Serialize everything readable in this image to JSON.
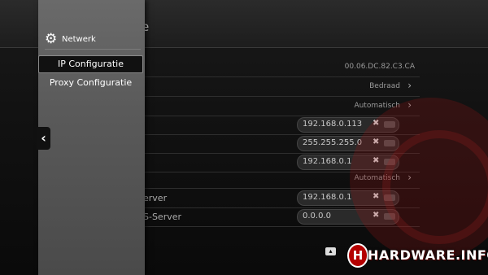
{
  "header": {
    "title": "e"
  },
  "sidebar": {
    "title": "Netwerk",
    "items": [
      {
        "label": "IP Configuratie"
      },
      {
        "label": "Proxy Configuratie"
      }
    ]
  },
  "rows": [
    {
      "label": "",
      "value": "00.06.DC.82.C3.CA"
    },
    {
      "label": "",
      "value": "Bedraad"
    },
    {
      "label": "",
      "value": "Automatisch"
    },
    {
      "label": "",
      "field": "192.168.0.113"
    },
    {
      "label": "",
      "field": "255.255.255.0"
    },
    {
      "label": "",
      "field": "192.168.0.1"
    },
    {
      "label": "",
      "value": "Automatisch"
    },
    {
      "label": "erver",
      "field": "192.168.0.1"
    },
    {
      "label": "S-Server",
      "field": "0.0.0.0"
    }
  ],
  "watermark": {
    "text": "HARDWARE.INFO",
    "logo_letter": "H"
  },
  "icons": {
    "gear": "gear-icon",
    "back": "chevron-left-icon",
    "clear": "clear-x-icon",
    "keyboard": "keyboard-icon"
  }
}
